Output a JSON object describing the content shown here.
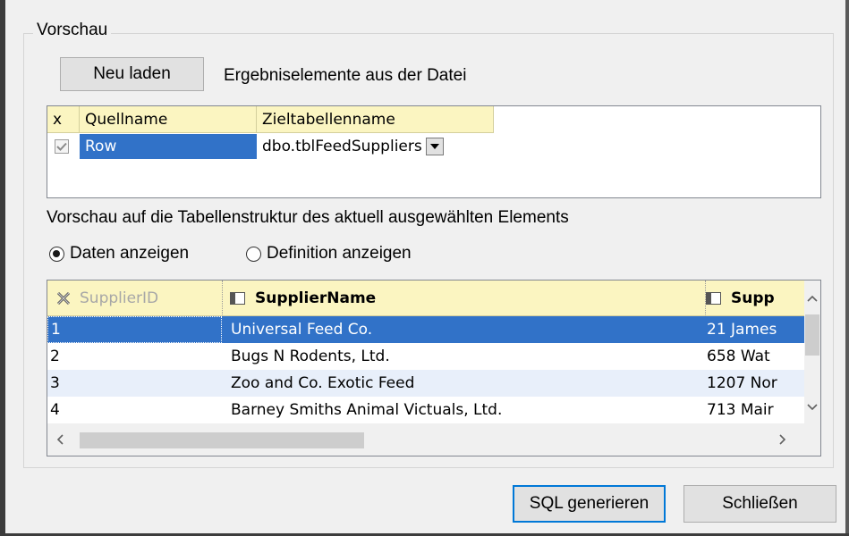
{
  "group_title": "Vorschau",
  "reload_button": "Neu laden",
  "result_label": "Ergebniselemente aus der Datei",
  "mapping": {
    "headers": {
      "x": "x",
      "source": "Quellname",
      "target": "Zieltabellenname"
    },
    "row": {
      "checked": true,
      "source": "Row",
      "target": "dbo.tblFeedSuppliers"
    }
  },
  "structure_label": "Vorschau auf die Tabellenstruktur des aktuell ausgewählten Elements",
  "radio_data": "Daten anzeigen",
  "radio_definition": "Definition anzeigen",
  "radio_selected": "data",
  "grid": {
    "columns": [
      "SupplierID",
      "SupplierName",
      "Supp"
    ],
    "rows": [
      {
        "id": "1",
        "name": "Universal Feed Co.",
        "addr": "21 James"
      },
      {
        "id": "2",
        "name": "Bugs N Rodents, Ltd.",
        "addr": "658 Wat"
      },
      {
        "id": "3",
        "name": "Zoo and Co. Exotic Feed",
        "addr": "1207 Nor"
      },
      {
        "id": "4",
        "name": "Barney Smiths Animal Victuals, Ltd.",
        "addr": "713 Mair"
      }
    ],
    "selected_row": 1
  },
  "generate_button": "SQL generieren",
  "close_button": "Schließen",
  "colors": {
    "header_bg": "#fbf5c1",
    "selected_row": "#3172c8",
    "alt_row": "#e8effa",
    "focus_border": "#0078d7"
  }
}
